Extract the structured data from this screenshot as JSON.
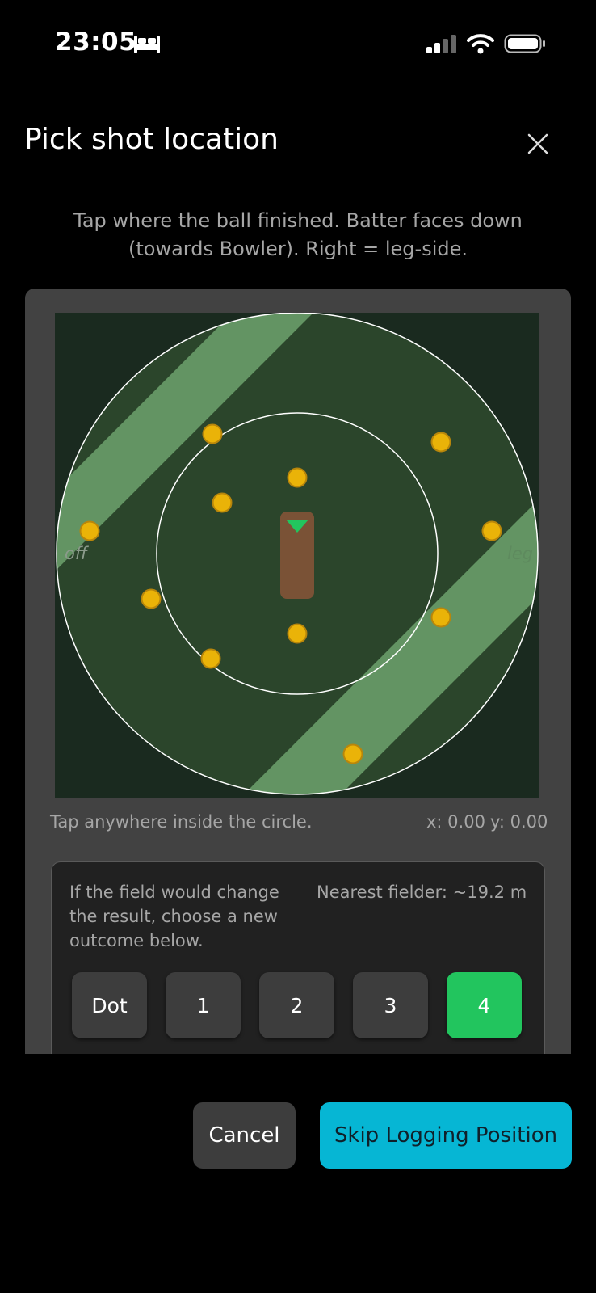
{
  "status_bar": {
    "time": "23:05",
    "icons": [
      "bed-icon",
      "cellular-signal-icon",
      "wifi-icon",
      "battery-icon"
    ]
  },
  "modal": {
    "title": "Pick shot location",
    "close_icon": "close-icon",
    "instructions": "Tap where the ball finished. Batter faces down (towards Bowler). Right = leg-side."
  },
  "field": {
    "off_label": "off",
    "leg_label": "leg",
    "colors": {
      "background": "#1a2a1f",
      "stripe_light": "#639463",
      "stripe_dark": "#2b452b",
      "boundary": "#ffffff",
      "pitch": "#7a5236",
      "fielder": "#eab308",
      "fielder_stroke": "#b8860b",
      "batter_marker": "#22c55e"
    }
  },
  "tap_hint": "Tap anywhere inside the circle.",
  "coords": {
    "x": "x: 0.00",
    "y": "y: 0.00"
  },
  "outcome": {
    "prompt": "If the field would change the result, choose a new outcome below.",
    "nearest_fielder": "Nearest fielder: ~19.2 m",
    "options": [
      "Dot",
      "1",
      "2",
      "3",
      "4"
    ],
    "selected": "4",
    "accent": "#22c55e"
  },
  "footer": {
    "cancel_label": "Cancel",
    "skip_label": "Skip Logging Position",
    "skip_color": "#06b6d4"
  }
}
